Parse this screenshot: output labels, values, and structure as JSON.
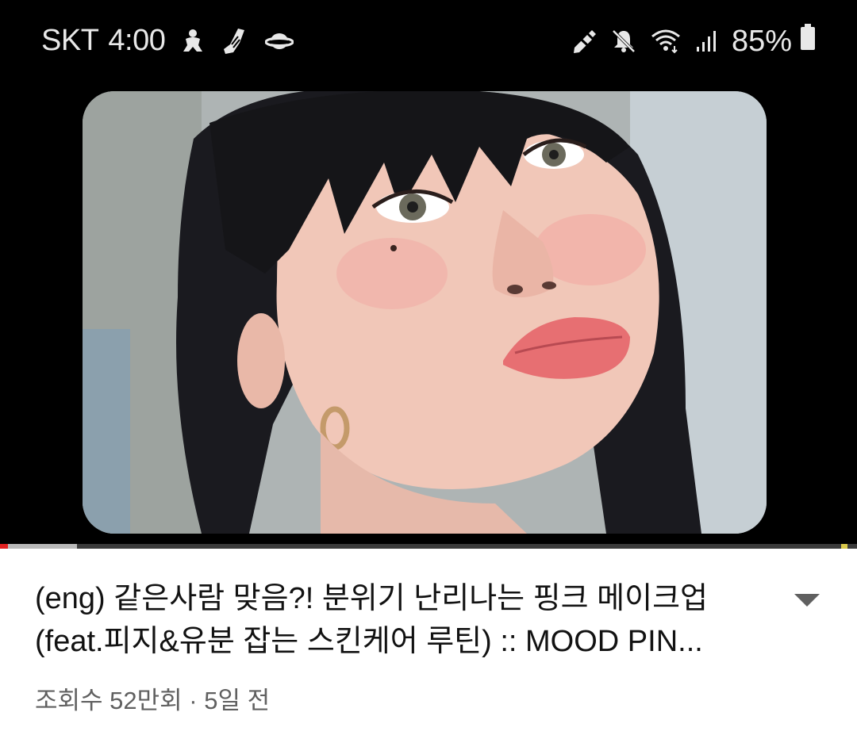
{
  "status_bar": {
    "carrier": "SKT",
    "time": "4:00",
    "app_icons": [
      "notification-person-icon",
      "notification-sneaker-icon",
      "notification-planet-icon"
    ],
    "right_icons": [
      "pencil-icon",
      "mute-icon",
      "wifi-icon",
      "signal-icon"
    ],
    "battery_percent": "85%",
    "colors": {
      "background": "#000000",
      "text": "#e8e8e8"
    }
  },
  "video": {
    "progress_played_fraction": 0.01,
    "progress_buffered_fraction": 0.09,
    "colors": {
      "played": "#e02020",
      "buffered": "#b9b9b9",
      "track": "#3b3b3b"
    }
  },
  "video_info": {
    "title_line1": "(eng) 같은사람 맞음?! 분위기 난리나는 핑크 메이크업",
    "title_line2": "(feat.피지&유분 잡는 스킨케어 루틴) :: MOOD PIN...",
    "meta": "조회수 52만회 · 5일 전",
    "expand_icon": "chevron-down-icon"
  }
}
